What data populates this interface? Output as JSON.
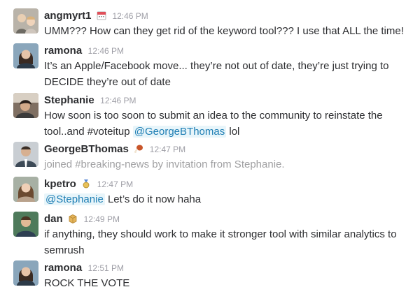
{
  "messages": [
    {
      "author": "angmyrt1",
      "time": "12:46 PM",
      "status_emoji": "calendar-icon",
      "text": "UMM??? How can they get rid of the keyword tool??? I use that ALL the time!"
    },
    {
      "author": "ramona",
      "time": "12:46 PM",
      "text": "It’s an Apple/Facebook move... they’re not out of date, they’re just trying to DECIDE they’re out of date"
    },
    {
      "author": "Stephanie",
      "time": "12:46 PM",
      "text_before": "How soon is too soon to submit an idea to the community to reinstate the tool..and #voteitup ",
      "mention": "@GeorgeBThomas",
      "text_after": " lol"
    },
    {
      "author": "GeorgeBThomas",
      "time": "12:47 PM",
      "status_emoji": "turkey-leg-icon",
      "text": "joined #breaking-news by invitation from Stephanie."
    },
    {
      "author": "kpetro",
      "time": "12:47 PM",
      "status_emoji": "sports-medal-icon",
      "mention": "@Stephanie",
      "text_after": " Let’s do it now haha"
    },
    {
      "author": "dan",
      "time": "12:49 PM",
      "status_emoji": "package-icon",
      "text": "if anything, they should work to make it stronger tool with similar analytics to semrush"
    },
    {
      "author": "ramona",
      "time": "12:51 PM",
      "text": "ROCK THE VOTE"
    }
  ],
  "colors": {
    "link": "#1e7eb4",
    "timestamp": "#9e9ea6",
    "system_text": "#a0a0a2"
  }
}
